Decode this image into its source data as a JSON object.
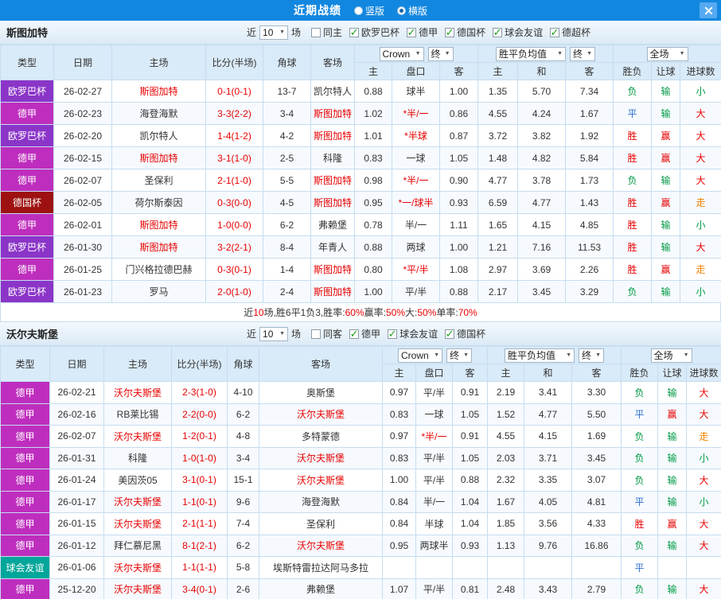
{
  "titlebar": {
    "title": "近期战绩",
    "vertical_label": "竖版",
    "horizontal_label": "横版"
  },
  "icons": {
    "dropdown_arrow": "▼",
    "check": "✓"
  },
  "filter_labels": {
    "near": "近",
    "games": "场"
  },
  "dropdowns": {
    "bookmaker": "Crown",
    "asian_time": "终",
    "euro_source": "胜平负均值",
    "euro_time": "终",
    "scope": "全场"
  },
  "columns": {
    "type": "类型",
    "date": "日期",
    "home": "主场",
    "score": "比分(半场)",
    "corner": "角球",
    "away": "客场",
    "a_home": "主",
    "a_line": "盘口",
    "a_away": "客",
    "e_home": "主",
    "e_draw": "和",
    "e_away": "客",
    "result": "胜负",
    "handicap": "让球",
    "goals": "进球数"
  },
  "colors": {
    "accent_blue": "#1287E0",
    "highlight_red": "#E80000",
    "leagues": {
      "欧罗巴杯": "#8B35C8",
      "德甲": "#BE2EBE",
      "德国杯": "#9E1111",
      "球会友谊": "#00A69A"
    },
    "outcomes": {
      "胜": "#E80000",
      "平": "#2E6FD0",
      "负": "#009944",
      "赢": "#E80000",
      "输": "#009944",
      "大": "#E80000",
      "小": "#009944",
      "走": "#F08200"
    }
  },
  "sections": [
    {
      "team": "斯图加特",
      "count": "10",
      "filters": [
        {
          "label": "同主",
          "checked": false
        },
        {
          "label": "欧罗巴杯",
          "checked": true
        },
        {
          "label": "德甲",
          "checked": true
        },
        {
          "label": "德国杯",
          "checked": true
        },
        {
          "label": "球会友谊",
          "checked": true
        },
        {
          "label": "德超杯",
          "checked": true
        }
      ],
      "rows": [
        {
          "type": "欧罗巴杯",
          "date": "26-02-27",
          "home": "斯图加特",
          "home_hl": true,
          "score": "0-1(0-1)",
          "corner": "13-7",
          "away": "凯尔特人",
          "ah": "0.88",
          "line": "球半",
          "aa": "1.00",
          "eh": "1.35",
          "ed": "5.70",
          "ea": "7.34",
          "res": "负",
          "hcp": "输",
          "goal": "小"
        },
        {
          "type": "德甲",
          "date": "26-02-23",
          "home": "海登海默",
          "score": "3-3(2-2)",
          "corner": "3-4",
          "away": "斯图加特",
          "away_hl": true,
          "ah": "1.02",
          "line": "*半/一",
          "aa": "0.86",
          "eh": "4.55",
          "ed": "4.24",
          "ea": "1.67",
          "res": "平",
          "hcp": "输",
          "goal": "大"
        },
        {
          "type": "欧罗巴杯",
          "date": "26-02-20",
          "home": "凯尔特人",
          "score": "1-4(1-2)",
          "corner": "4-2",
          "away": "斯图加特",
          "away_hl": true,
          "ah": "1.01",
          "line": "*半球",
          "aa": "0.87",
          "eh": "3.72",
          "ed": "3.82",
          "ea": "1.92",
          "res": "胜",
          "hcp": "赢",
          "goal": "大"
        },
        {
          "type": "德甲",
          "date": "26-02-15",
          "home": "斯图加特",
          "home_hl": true,
          "score": "3-1(1-0)",
          "corner": "2-5",
          "away": "科隆",
          "ah": "0.83",
          "line": "一球",
          "aa": "1.05",
          "eh": "1.48",
          "ed": "4.82",
          "ea": "5.84",
          "res": "胜",
          "hcp": "赢",
          "goal": "大"
        },
        {
          "type": "德甲",
          "date": "26-02-07",
          "home": "圣保利",
          "score": "2-1(1-0)",
          "corner": "5-5",
          "away": "斯图加特",
          "away_hl": true,
          "ah": "0.98",
          "line": "*半/一",
          "aa": "0.90",
          "eh": "4.77",
          "ed": "3.78",
          "ea": "1.73",
          "res": "负",
          "hcp": "输",
          "goal": "大"
        },
        {
          "type": "德国杯",
          "date": "26-02-05",
          "home": "荷尔斯泰因",
          "score": "0-3(0-0)",
          "corner": "4-5",
          "away": "斯图加特",
          "away_hl": true,
          "ah": "0.95",
          "line": "*一/球半",
          "aa": "0.93",
          "eh": "6.59",
          "ed": "4.77",
          "ea": "1.43",
          "res": "胜",
          "hcp": "赢",
          "goal": "走"
        },
        {
          "type": "德甲",
          "date": "26-02-01",
          "home": "斯图加特",
          "home_hl": true,
          "score": "1-0(0-0)",
          "corner": "6-2",
          "away": "弗赖堡",
          "ah": "0.78",
          "line": "半/一",
          "aa": "1.11",
          "eh": "1.65",
          "ed": "4.15",
          "ea": "4.85",
          "res": "胜",
          "hcp": "输",
          "goal": "小"
        },
        {
          "type": "欧罗巴杯",
          "date": "26-01-30",
          "home": "斯图加特",
          "home_hl": true,
          "score": "3-2(2-1)",
          "corner": "8-4",
          "away": "年青人",
          "ah": "0.88",
          "line": "两球",
          "aa": "1.00",
          "eh": "1.21",
          "ed": "7.16",
          "ea": "11.53",
          "res": "胜",
          "hcp": "输",
          "goal": "大"
        },
        {
          "type": "德甲",
          "date": "26-01-25",
          "home": "门兴格拉德巴赫",
          "score": "0-3(0-1)",
          "corner": "1-4",
          "away": "斯图加特",
          "away_hl": true,
          "ah": "0.80",
          "line": "*平/半",
          "aa": "1.08",
          "eh": "2.97",
          "ed": "3.69",
          "ea": "2.26",
          "res": "胜",
          "hcp": "赢",
          "goal": "走"
        },
        {
          "type": "欧罗巴杯",
          "date": "26-01-23",
          "home": "罗马",
          "score": "2-0(1-0)",
          "corner": "2-4",
          "away": "斯图加特",
          "away_hl": true,
          "ah": "1.00",
          "line": "平/半",
          "aa": "0.88",
          "eh": "2.17",
          "ed": "3.45",
          "ea": "3.29",
          "res": "负",
          "hcp": "输",
          "goal": "小"
        }
      ],
      "summary": [
        {
          "t": "近",
          "c": "#333333"
        },
        {
          "t": "10",
          "c": "#E80000"
        },
        {
          "t": "场,胜6平1负3, ",
          "c": "#333333"
        },
        {
          "t": "胜率:",
          "c": "#333333"
        },
        {
          "t": "60%",
          "c": "#E80000"
        },
        {
          "t": " 赢率:",
          "c": "#333333"
        },
        {
          "t": "50%",
          "c": "#E80000"
        },
        {
          "t": " 大:",
          "c": "#333333"
        },
        {
          "t": "50%",
          "c": "#E80000"
        },
        {
          "t": " 单率:",
          "c": "#333333"
        },
        {
          "t": "70%",
          "c": "#E80000"
        }
      ]
    },
    {
      "team": "沃尔夫斯堡",
      "count": "10",
      "filters": [
        {
          "label": "同客",
          "checked": false
        },
        {
          "label": "德甲",
          "checked": true
        },
        {
          "label": "球会友谊",
          "checked": true
        },
        {
          "label": "德国杯",
          "checked": true
        }
      ],
      "rows": [
        {
          "type": "德甲",
          "date": "26-02-21",
          "home": "沃尔夫斯堡",
          "home_hl": true,
          "score": "2-3(1-0)",
          "corner": "4-10",
          "away": "奥斯堡",
          "ah": "0.97",
          "line": "平/半",
          "aa": "0.91",
          "eh": "2.19",
          "ed": "3.41",
          "ea": "3.30",
          "res": "负",
          "hcp": "输",
          "goal": "大"
        },
        {
          "type": "德甲",
          "date": "26-02-16",
          "home": "RB莱比锡",
          "score": "2-2(0-0)",
          "corner": "6-2",
          "away": "沃尔夫斯堡",
          "away_hl": true,
          "ah": "0.83",
          "line": "一球",
          "aa": "1.05",
          "eh": "1.52",
          "ed": "4.77",
          "ea": "5.50",
          "res": "平",
          "hcp": "赢",
          "goal": "大"
        },
        {
          "type": "德甲",
          "date": "26-02-07",
          "home": "沃尔夫斯堡",
          "home_hl": true,
          "score": "1-2(0-1)",
          "corner": "4-8",
          "away": "多特蒙德",
          "ah": "0.97",
          "line": "*半/一",
          "aa": "0.91",
          "eh": "4.55",
          "ed": "4.15",
          "ea": "1.69",
          "res": "负",
          "hcp": "输",
          "goal": "走"
        },
        {
          "type": "德甲",
          "date": "26-01-31",
          "home": "科隆",
          "score": "1-0(1-0)",
          "corner": "3-4",
          "away": "沃尔夫斯堡",
          "away_hl": true,
          "ah": "0.83",
          "line": "平/半",
          "aa": "1.05",
          "eh": "2.03",
          "ed": "3.71",
          "ea": "3.45",
          "res": "负",
          "hcp": "输",
          "goal": "小"
        },
        {
          "type": "德甲",
          "date": "26-01-24",
          "home": "美因茨05",
          "score": "3-1(0-1)",
          "corner": "15-1",
          "away": "沃尔夫斯堡",
          "away_hl": true,
          "ah": "1.00",
          "line": "平/半",
          "aa": "0.88",
          "eh": "2.32",
          "ed": "3.35",
          "ea": "3.07",
          "res": "负",
          "hcp": "输",
          "goal": "大"
        },
        {
          "type": "德甲",
          "date": "26-01-17",
          "home": "沃尔夫斯堡",
          "home_hl": true,
          "score": "1-1(0-1)",
          "corner": "9-6",
          "away": "海登海默",
          "ah": "0.84",
          "line": "半/一",
          "aa": "1.04",
          "eh": "1.67",
          "ed": "4.05",
          "ea": "4.81",
          "res": "平",
          "hcp": "输",
          "goal": "小"
        },
        {
          "type": "德甲",
          "date": "26-01-15",
          "home": "沃尔夫斯堡",
          "home_hl": true,
          "score": "2-1(1-1)",
          "corner": "7-4",
          "away": "圣保利",
          "ah": "0.84",
          "line": "半球",
          "aa": "1.04",
          "eh": "1.85",
          "ed": "3.56",
          "ea": "4.33",
          "res": "胜",
          "hcp": "赢",
          "goal": "大"
        },
        {
          "type": "德甲",
          "date": "26-01-12",
          "home": "拜仁慕尼黑",
          "score": "8-1(2-1)",
          "corner": "6-2",
          "away": "沃尔夫斯堡",
          "away_hl": true,
          "ah": "0.95",
          "line": "两球半",
          "aa": "0.93",
          "eh": "1.13",
          "ed": "9.76",
          "ea": "16.86",
          "res": "负",
          "hcp": "输",
          "goal": "大"
        },
        {
          "type": "球会友谊",
          "date": "26-01-06",
          "home": "沃尔夫斯堡",
          "home_hl": true,
          "score": "1-1(1-1)",
          "corner": "5-8",
          "away": "埃斯特雷拉达阿马多拉",
          "ah": "",
          "line": "",
          "aa": "",
          "eh": "",
          "ed": "",
          "ea": "",
          "res": "平",
          "hcp": "",
          "goal": ""
        },
        {
          "type": "德甲",
          "date": "25-12-20",
          "home": "沃尔夫斯堡",
          "home_hl": true,
          "score": "3-4(0-1)",
          "corner": "2-6",
          "away": "弗赖堡",
          "ah": "1.07",
          "line": "平/半",
          "aa": "0.81",
          "eh": "2.48",
          "ed": "3.43",
          "ea": "2.79",
          "res": "负",
          "hcp": "输",
          "goal": "大"
        }
      ]
    }
  ]
}
